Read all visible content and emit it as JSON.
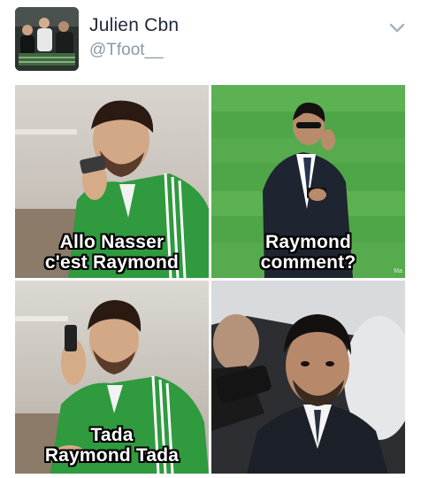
{
  "tweet": {
    "author": {
      "display_name": "Julien Cbn",
      "handle": "@Tfoot__"
    },
    "menu_icon": "chevron-down-icon"
  },
  "meme": {
    "panels": [
      {
        "id": "top-left",
        "caption_line1": "Allo Nasser",
        "caption_line2": "c'est Raymond"
      },
      {
        "id": "top-right",
        "caption_line1": "Raymond",
        "caption_line2": "comment?",
        "watermark": "Ma"
      },
      {
        "id": "bottom-left",
        "caption_line1": "Tada",
        "caption_line2": "Raymond Tada"
      },
      {
        "id": "bottom-right"
      }
    ]
  },
  "colors": {
    "name_text": "#1c2938",
    "handle_text": "#8899a6",
    "jacket_green": "#2f9a3e",
    "pitch_green": "#4fa648"
  }
}
